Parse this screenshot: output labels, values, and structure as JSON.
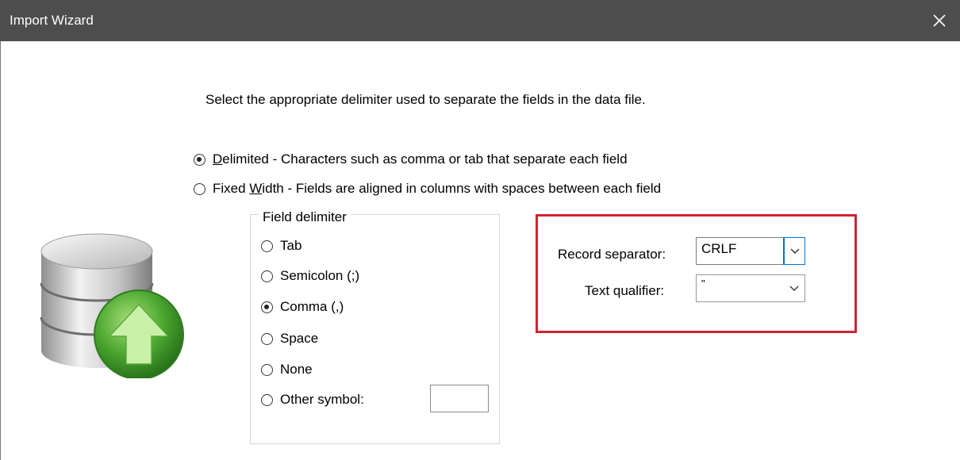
{
  "window": {
    "title": "Import Wizard",
    "close_icon": "close-icon"
  },
  "instruction": "Select the appropriate delimiter used to separate the fields in the data file.",
  "format_options": [
    {
      "accel": "D",
      "rest": "elimited - Characters such as comma or tab that separate each field",
      "checked": true
    },
    {
      "prefix": "Fixed ",
      "accel": "W",
      "rest": "idth - Fields are aligned in columns with spaces between each field",
      "checked": false
    }
  ],
  "field_delimiter": {
    "legend": "Field delimiter",
    "options": [
      {
        "label": "Tab",
        "checked": false
      },
      {
        "label": "Semicolon (;)",
        "checked": false
      },
      {
        "label": "Comma (,)",
        "checked": true
      },
      {
        "label": "Space",
        "checked": false
      },
      {
        "label": "None",
        "checked": false
      },
      {
        "label": "Other symbol:",
        "checked": false
      }
    ],
    "other_symbol_value": ""
  },
  "record_separator": {
    "label": "Record separator:",
    "value": "CRLF"
  },
  "text_qualifier": {
    "label": "Text qualifier:",
    "value": "\""
  },
  "colors": {
    "titlebar": "#4d4d4d",
    "highlight_border": "#d02432",
    "focus_blue": "#0078d7",
    "icon_green": "#3f9d2a"
  },
  "icons": [
    "database-icon",
    "upload-arrow-icon",
    "chevron-down-icon",
    "close-icon"
  ]
}
